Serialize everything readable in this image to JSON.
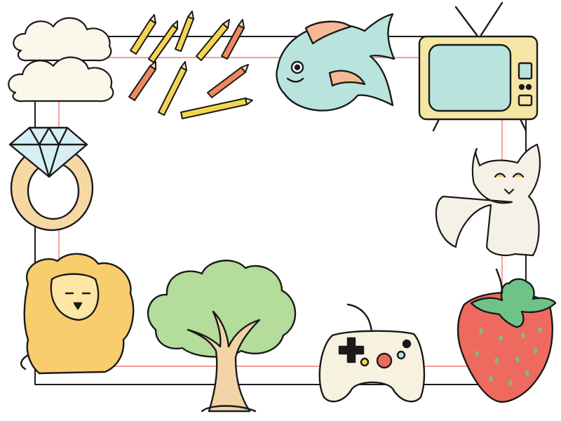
{
  "frame": {
    "outer_border_color": "#1a1a1a",
    "inner_border_color": "#f07c74"
  },
  "illustrations": [
    {
      "name": "clouds",
      "icon": "cloud-icon"
    },
    {
      "name": "pencils",
      "icon": "pencil-icon"
    },
    {
      "name": "fish",
      "icon": "fish-icon"
    },
    {
      "name": "retro-tv",
      "icon": "tv-icon"
    },
    {
      "name": "diamond-ring",
      "icon": "ring-icon"
    },
    {
      "name": "cat",
      "icon": "cat-icon"
    },
    {
      "name": "lion",
      "icon": "lion-icon"
    },
    {
      "name": "tree",
      "icon": "tree-icon"
    },
    {
      "name": "game-controller",
      "icon": "gamepad-icon"
    },
    {
      "name": "strawberry",
      "icon": "strawberry-icon"
    }
  ],
  "colors": {
    "cloud": "#fbf7ea",
    "pencil_body": "#f6d44f",
    "pencil_body_alt": "#ef8a5e",
    "fish": "#b8e4dd",
    "fish_accent": "#f5b996",
    "tv_body": "#f6e6a6",
    "tv_screen": "#b8e4dd",
    "ring_gem": "#d6eef4",
    "ring_band": "#f6d8a4",
    "cat": "#f6f1e6",
    "lion": "#f8cd6d",
    "tree_foliage": "#b4dc9a",
    "tree_trunk": "#f2d4a6",
    "controller": "#f7f1df",
    "strawberry": "#ef6a5e",
    "strawberry_leaf": "#6fc389"
  }
}
